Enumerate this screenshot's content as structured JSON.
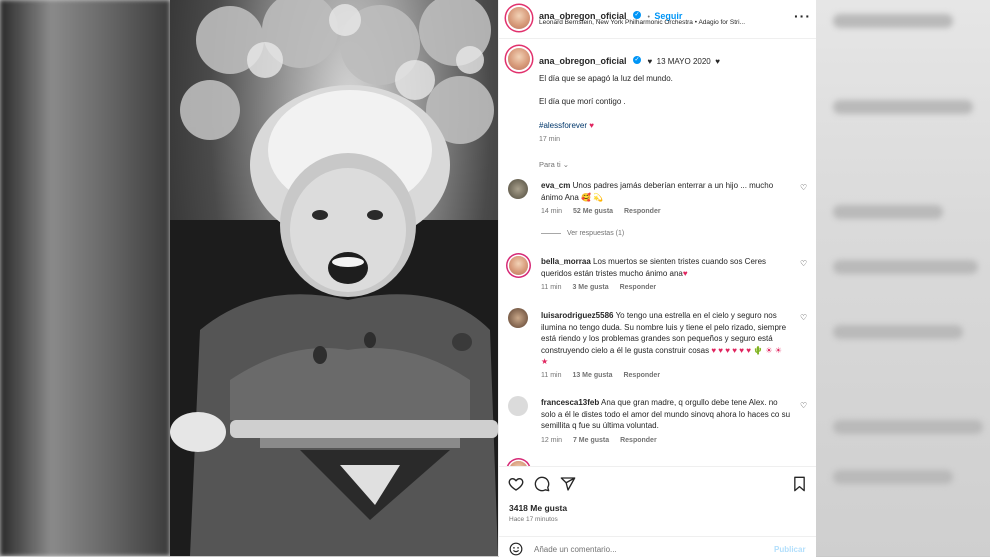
{
  "header": {
    "username": "ana_obregon_oficial",
    "follow_label": "Seguir",
    "audio": "Leonard Bernstein, New York Philharmonic Orchestra • Adagio for Stri..."
  },
  "caption": {
    "username": "ana_obregon_oficial",
    "date": "13 MAYO 2020",
    "line1": "El día que se apagó la luz del mundo.",
    "line2": "El día que morí contigo .",
    "hashtag": "#alessforever",
    "time": "17 min"
  },
  "sort_label": "Para ti",
  "comments": [
    {
      "user": "eva_cm",
      "text": "Unos padres jamás deberían enterrar a un hijo ... mucho ánimo Ana 🥰 💫",
      "time": "14 min",
      "likes": "52 Me gusta",
      "reply": "Responder",
      "replies": "Ver respuestas (1)"
    },
    {
      "user": "bella_morraa",
      "text": "Los muertos se sienten tristes cuando sos Ceres queridos están tristes mucho ánimo ana",
      "time": "11 min",
      "likes": "3 Me gusta",
      "reply": "Responder"
    },
    {
      "user": "luisarodriguez5586",
      "text": "Yo tengo una estrella en el cielo y seguro nos ilumina no tengo duda. Su nombre luis y tiene el pelo rizado, siempre está riendo y los problemas grandes son pequeños y seguro está construyendo cielo a él le gusta construir cosas",
      "emoji": "♥ ♥ ♥ ♥ ♥ ♥ 🌵 ☀ ☀ ★",
      "time": "11 min",
      "likes": "13 Me gusta",
      "reply": "Responder"
    },
    {
      "user": "francesca13feb",
      "text": "Ana que gran madre, q orgullo debe tene Alex. no solo a él le distes todo el amor del mundo sinovq ahora lo haces co su semillita q fue su última voluntad.",
      "time": "12 min",
      "likes": "7 Me gusta",
      "reply": "Responder"
    }
  ],
  "likes_count": "3418 Me gusta",
  "posted_ago": "Hace 17 minutos",
  "comment_placeholder": "Añade un comentario...",
  "publish_label": "Publicar",
  "colors": {
    "accent": "#0095f6",
    "heart": "#e0245e",
    "text": "#262626",
    "muted": "#737373"
  }
}
